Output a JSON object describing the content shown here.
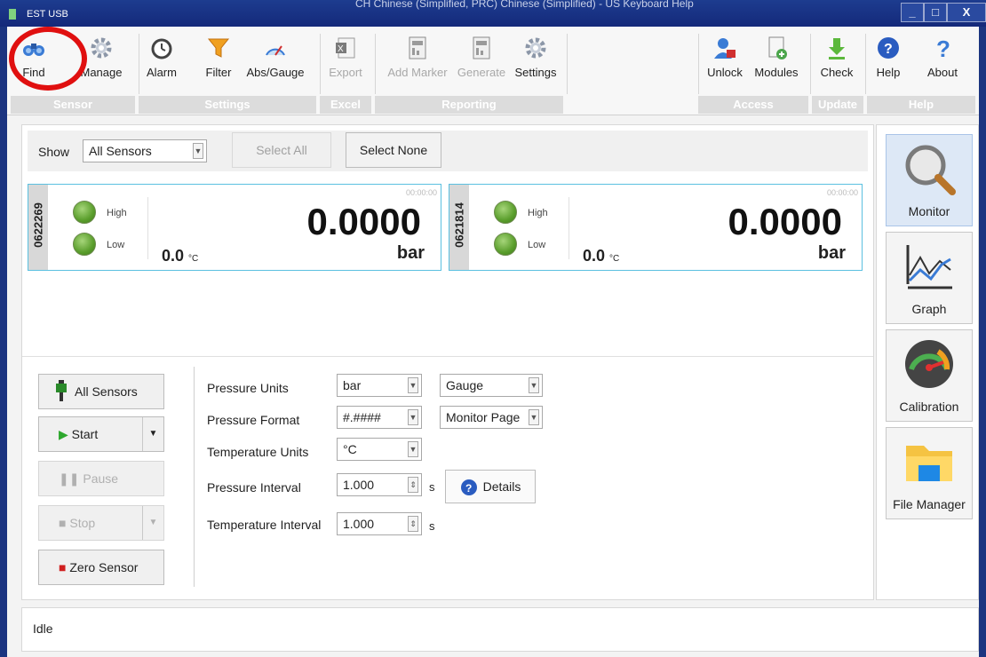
{
  "window": {
    "title": "EST USB",
    "ime_bar": "CH Chinese (Simplified, PRC)   Chinese (Simplified) - US Keyboard   Help",
    "minimize": "_",
    "maximize": "□",
    "close": "X"
  },
  "ribbon": {
    "groups": [
      {
        "label": "Sensor"
      },
      {
        "label": "Settings"
      },
      {
        "label": "Excel"
      },
      {
        "label": "Reporting"
      },
      {
        "label": "Access"
      },
      {
        "label": "Update"
      },
      {
        "label": "Help"
      }
    ],
    "buttons": {
      "find": "Find",
      "manage": "Manage",
      "alarm": "Alarm",
      "filter": "Filter",
      "absgauge": "Abs/Gauge",
      "export": "Export",
      "add_marker": "Add Marker",
      "generate": "Generate",
      "settings": "Settings",
      "unlock": "Unlock",
      "modules": "Modules",
      "check": "Check",
      "help": "Help",
      "about": "About"
    }
  },
  "showbar": {
    "show_label": "Show",
    "filter_value": "All Sensors",
    "select_all": "Select All",
    "select_none": "Select None"
  },
  "sensors": [
    {
      "id": "0622269",
      "high": "High",
      "low": "Low",
      "time": "00:00:00",
      "pressure": "0.0000",
      "unit": "bar",
      "temp": "0.0",
      "temp_unit": "°C"
    },
    {
      "id": "0621814",
      "high": "High",
      "low": "Low",
      "time": "00:00:00",
      "pressure": "0.0000",
      "unit": "bar",
      "temp": "0.0",
      "temp_unit": "°C"
    }
  ],
  "controls": {
    "all_sensors": "All Sensors",
    "start": "Start",
    "pause": "Pause",
    "stop": "Stop",
    "zero_sensor": "Zero Sensor"
  },
  "settings": {
    "pressure_units_label": "Pressure Units",
    "pressure_units_value": "bar",
    "pressure_mode_value": "Gauge",
    "pressure_format_label": "Pressure Format",
    "pressure_format_value": "#.####",
    "format_page_value": "Monitor Page",
    "temperature_units_label": "Temperature Units",
    "temperature_units_value": "°C",
    "pressure_interval_label": "Pressure Interval",
    "pressure_interval_value": "1.000",
    "pressure_interval_unit": "s",
    "temperature_interval_label": "Temperature Interval",
    "temperature_interval_value": "1.000",
    "temperature_interval_unit": "s",
    "details": "Details"
  },
  "nav": {
    "monitor": "Monitor",
    "graph": "Graph",
    "calibration": "Calibration",
    "file_manager": "File Manager"
  },
  "status": {
    "text": "Idle"
  },
  "colors": {
    "accent_border": "#5bc0e0",
    "highlight_circle": "#e01010",
    "led_green": "#5a9e2c"
  }
}
